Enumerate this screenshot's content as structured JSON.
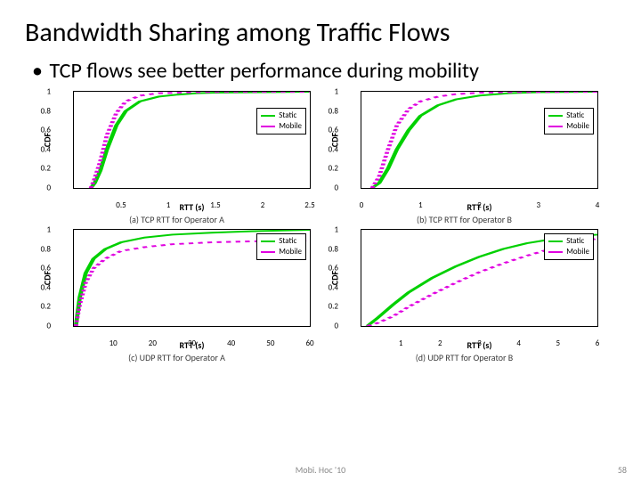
{
  "slide": {
    "title": "Bandwidth Sharing among Traffic Flows",
    "bullet": "TCP flows see better performance during mobility",
    "footer_center": "Mobi. Hoc '10",
    "page_number": "58"
  },
  "legend": {
    "static": "Static",
    "mobile": "Mobile"
  },
  "labels": {
    "cdf": "CDF",
    "rtt_s": "RTT (s)"
  },
  "captions": {
    "a": "(a) TCP RTT for Operator A",
    "b": "(b) TCP RTT for Operator B",
    "c": "(c) UDP RTT for Operator A",
    "d": "(d) UDP RTT for Operator B"
  },
  "chart_data": [
    {
      "id": "a",
      "type": "line",
      "title": "(a) TCP RTT for Operator A",
      "xlabel": "RTT (s)",
      "ylabel": "CDF",
      "xlim": [
        0,
        2.5
      ],
      "ylim": [
        0,
        1
      ],
      "x_ticks": [
        0.5,
        1,
        1.5,
        2,
        2.5
      ],
      "y_ticks": [
        0,
        0.2,
        0.4,
        0.6,
        0.8,
        1
      ],
      "series": [
        {
          "name": "Static",
          "x": [
            0.18,
            0.22,
            0.28,
            0.35,
            0.45,
            0.55,
            0.7,
            0.9,
            1.1,
            1.3,
            1.5,
            2.0,
            2.5
          ],
          "y": [
            0.0,
            0.05,
            0.18,
            0.4,
            0.65,
            0.8,
            0.9,
            0.95,
            0.97,
            0.985,
            0.99,
            0.995,
            1.0
          ]
        },
        {
          "name": "Mobile",
          "x": [
            0.18,
            0.22,
            0.28,
            0.35,
            0.45,
            0.55,
            0.7,
            0.9,
            1.1,
            1.3,
            1.5,
            2.0,
            2.5
          ],
          "y": [
            0.0,
            0.1,
            0.28,
            0.55,
            0.78,
            0.9,
            0.96,
            0.985,
            0.99,
            0.995,
            0.998,
            0.999,
            1.0
          ]
        }
      ]
    },
    {
      "id": "b",
      "type": "line",
      "title": "(b) TCP RTT for Operator B",
      "xlabel": "RTT (s)",
      "ylabel": "CDF",
      "xlim": [
        0,
        4
      ],
      "ylim": [
        0,
        1
      ],
      "x_ticks": [
        0,
        1,
        2,
        3,
        4
      ],
      "y_ticks": [
        0,
        0.2,
        0.4,
        0.6,
        0.8,
        1
      ],
      "series": [
        {
          "name": "Static",
          "x": [
            0.18,
            0.3,
            0.45,
            0.6,
            0.8,
            1.0,
            1.3,
            1.6,
            2.0,
            2.5,
            3.0,
            3.5,
            4.0
          ],
          "y": [
            0.0,
            0.05,
            0.2,
            0.4,
            0.6,
            0.75,
            0.86,
            0.92,
            0.96,
            0.985,
            0.995,
            0.998,
            1.0
          ]
        },
        {
          "name": "Mobile",
          "x": [
            0.18,
            0.3,
            0.45,
            0.6,
            0.8,
            1.0,
            1.3,
            1.6,
            2.0,
            2.5,
            3.0,
            3.5,
            4.0
          ],
          "y": [
            0.0,
            0.12,
            0.4,
            0.65,
            0.82,
            0.9,
            0.95,
            0.975,
            0.99,
            0.995,
            0.998,
            0.999,
            1.0
          ]
        }
      ]
    },
    {
      "id": "c",
      "type": "line",
      "title": "(c) UDP RTT for Operator A",
      "xlabel": "RTT (s)",
      "ylabel": "CDF",
      "xlim": [
        0,
        60
      ],
      "ylim": [
        0,
        1
      ],
      "x_ticks": [
        10,
        20,
        30,
        40,
        50,
        60
      ],
      "y_ticks": [
        0,
        0.2,
        0.4,
        0.6,
        0.8,
        1
      ],
      "series": [
        {
          "name": "Static",
          "x": [
            0.5,
            1.5,
            3,
            5,
            8,
            12,
            18,
            25,
            35,
            45,
            55,
            60
          ],
          "y": [
            0.0,
            0.3,
            0.55,
            0.7,
            0.8,
            0.87,
            0.92,
            0.95,
            0.97,
            0.985,
            0.995,
            1.0
          ]
        },
        {
          "name": "Mobile",
          "x": [
            0.5,
            1.5,
            3,
            5,
            8,
            12,
            18,
            25,
            35,
            45,
            55,
            60
          ],
          "y": [
            0.0,
            0.22,
            0.45,
            0.6,
            0.7,
            0.78,
            0.82,
            0.85,
            0.87,
            0.88,
            0.885,
            0.89
          ]
        }
      ]
    },
    {
      "id": "d",
      "type": "line",
      "title": "(d) UDP RTT for Operator B",
      "xlabel": "RTT (s)",
      "ylabel": "CDF",
      "xlim": [
        0,
        6
      ],
      "ylim": [
        0,
        1
      ],
      "x_ticks": [
        1,
        2,
        3,
        4,
        5,
        6
      ],
      "y_ticks": [
        0,
        0.2,
        0.4,
        0.6,
        0.8,
        1
      ],
      "series": [
        {
          "name": "Static",
          "x": [
            0.15,
            0.4,
            0.8,
            1.2,
            1.8,
            2.4,
            3.0,
            3.6,
            4.2,
            4.8,
            5.4,
            6.0
          ],
          "y": [
            0.0,
            0.08,
            0.22,
            0.35,
            0.5,
            0.62,
            0.72,
            0.8,
            0.86,
            0.9,
            0.93,
            0.95
          ]
        },
        {
          "name": "Mobile",
          "x": [
            0.15,
            0.4,
            0.8,
            1.2,
            1.8,
            2.4,
            3.0,
            3.6,
            4.2,
            4.8,
            5.4,
            6.0
          ],
          "y": [
            0.0,
            0.03,
            0.1,
            0.2,
            0.33,
            0.45,
            0.56,
            0.65,
            0.73,
            0.8,
            0.86,
            0.91
          ]
        }
      ]
    }
  ]
}
